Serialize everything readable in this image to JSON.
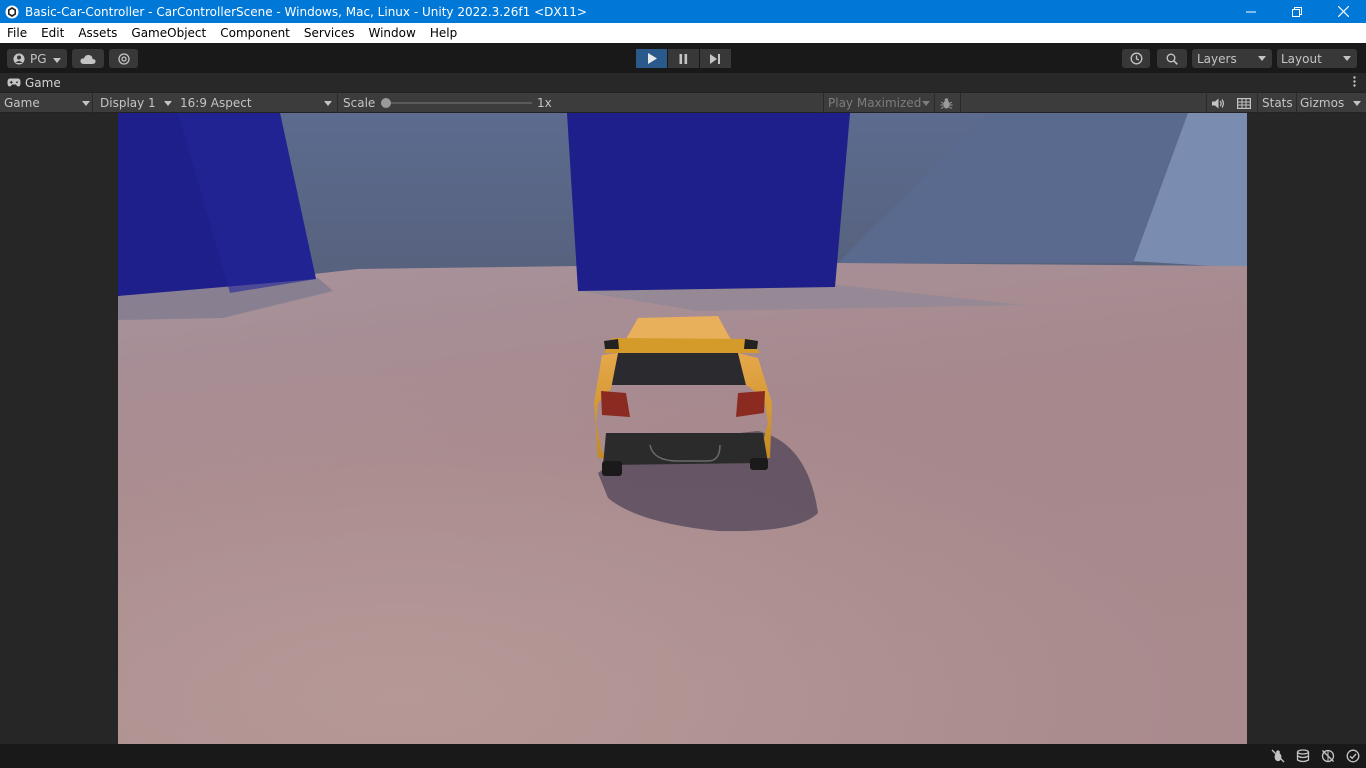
{
  "window": {
    "title": "Basic-Car-Controller - CarControllerScene - Windows, Mac, Linux - Unity 2022.3.26f1 <DX11>",
    "controls": [
      "minimize-icon",
      "restore-icon",
      "close-icon"
    ]
  },
  "menubar": {
    "items": [
      "File",
      "Edit",
      "Assets",
      "GameObject",
      "Component",
      "Services",
      "Window",
      "Help"
    ]
  },
  "toolbar": {
    "account_label": "PG",
    "play_state": "playing",
    "layers_label": "Layers",
    "layout_label": "Layout"
  },
  "game_tab": {
    "label": "Game"
  },
  "game_toolbar": {
    "view_mode": "Game",
    "display": "Display 1",
    "aspect": "16:9 Aspect",
    "scale_label": "Scale",
    "scale_value": "1x",
    "play_maximized": "Play Maximized",
    "stats_label": "Stats",
    "gizmos_label": "Gizmos"
  },
  "colors": {
    "titlebar": "#0078d7",
    "play_active": "#2a5a8c",
    "editor_bg": "#191919",
    "car": "#d49a2a",
    "blue_blocks": "#1e1f8a"
  }
}
